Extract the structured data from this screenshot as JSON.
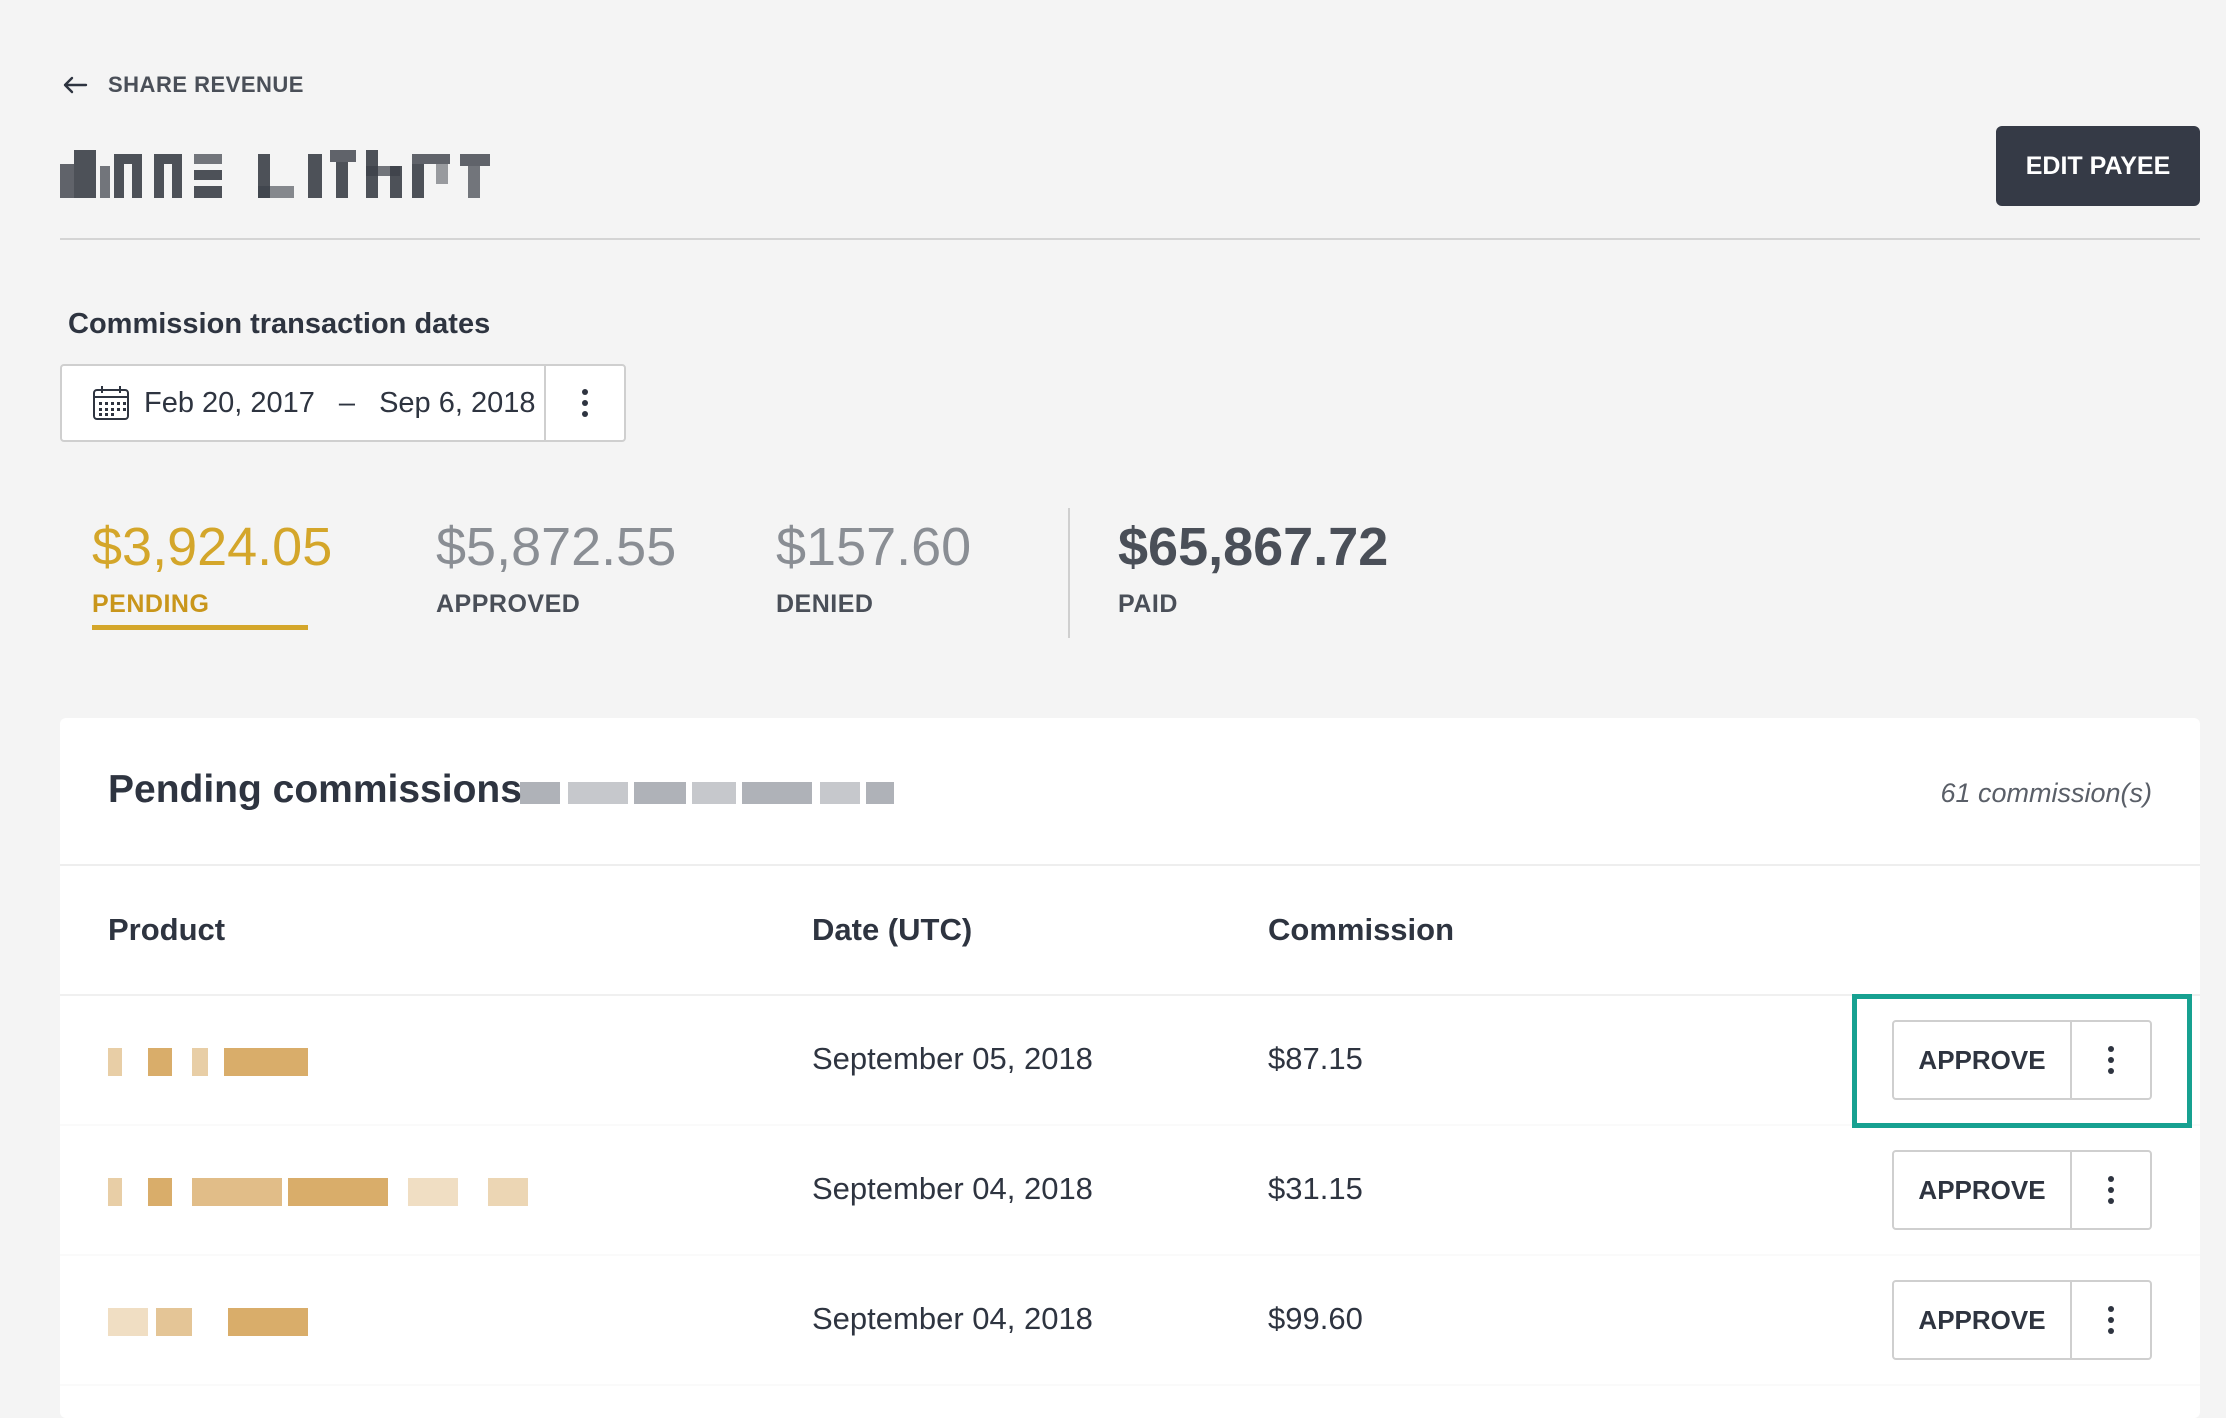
{
  "header": {
    "back_label": "SHARE REVENUE",
    "payee_name_redacted": true,
    "edit_button": "EDIT PAYEE"
  },
  "date_filter": {
    "heading": "Commission transaction dates",
    "start": "Feb 20, 2017",
    "separator": "–",
    "end": "Sep 6, 2018"
  },
  "summary": [
    {
      "amount": "$3,924.05",
      "label": "PENDING",
      "active": true
    },
    {
      "amount": "$5,872.55",
      "label": "APPROVED",
      "active": false
    },
    {
      "amount": "$157.60",
      "label": "DENIED",
      "active": false
    },
    {
      "amount": "$65,867.72",
      "label": "PAID",
      "active": false
    }
  ],
  "table": {
    "title": "Pending commissions",
    "count": "61 commission(s)",
    "columns": [
      "Product",
      "Date (UTC)",
      "Commission"
    ],
    "rows": [
      {
        "date": "September 05, 2018",
        "commission": "$87.15",
        "action": "APPROVE"
      },
      {
        "date": "September 04, 2018",
        "commission": "$31.15",
        "action": "APPROVE"
      },
      {
        "date": "September 04, 2018",
        "commission": "$99.60",
        "action": "APPROVE"
      }
    ]
  },
  "colors": {
    "pending_accent": "#d4a62a",
    "primary_button": "#353a46",
    "highlight": "#17a191"
  }
}
